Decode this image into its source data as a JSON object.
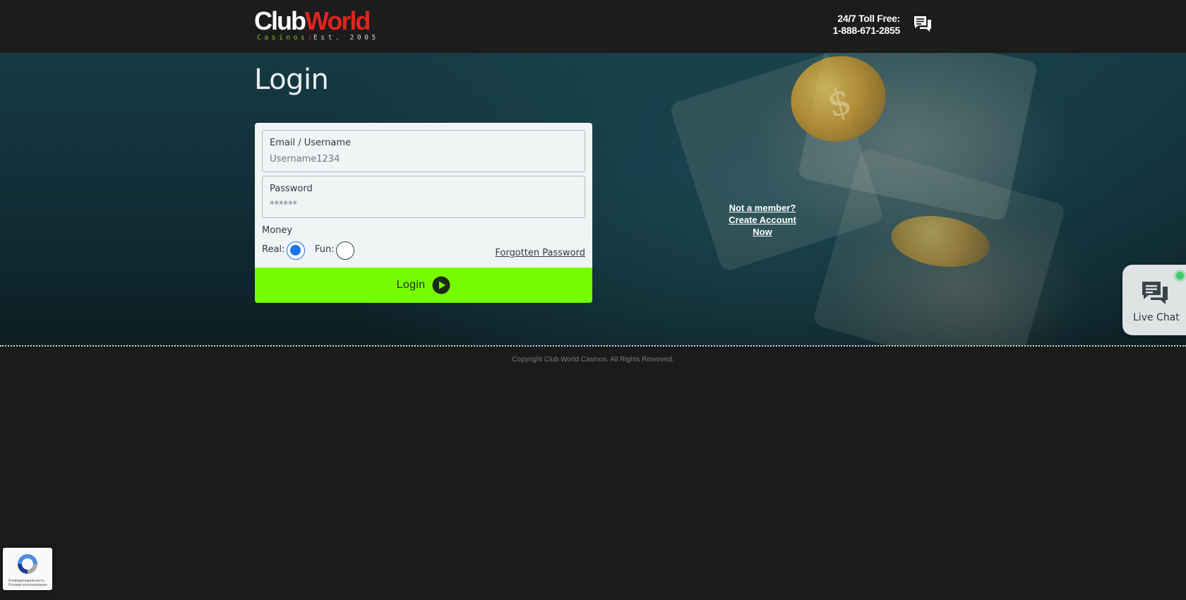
{
  "header": {
    "logo": {
      "club": "Club",
      "world": "World",
      "casinos": "Casinos",
      "separator": "|",
      "est": "Est. 2005"
    },
    "toll_free_label": "24/7 Toll Free:",
    "toll_free_number": "1-888-671-2855",
    "chat_icon": "chat-bubbles-icon"
  },
  "page": {
    "title": "Login"
  },
  "form": {
    "email_label": "Email / Username",
    "email_placeholder": "Username1234",
    "password_label": "Password",
    "password_placeholder": "******",
    "money_label": "Money",
    "real_label": "Real:",
    "fun_label": "Fun:",
    "selected_money": "Real",
    "forgot_label": "Forgotten Password",
    "login_label": "Login",
    "login_icon": "play-circle-icon"
  },
  "signup": {
    "line1": "Not a member?",
    "line2": "Create Account Now"
  },
  "live_chat": {
    "label": "Live Chat",
    "status": "online",
    "icon": "chat-bubbles-icon"
  },
  "footer": {
    "copyright": "Copyright Club World Casinos. All Rights Reserved."
  },
  "recaptcha": {
    "text": "Конфиденциальность - Условия использования"
  },
  "colors": {
    "header_bg": "#1c1c1c",
    "accent_green": "#76fc00",
    "logo_red": "#e3231f",
    "logo_green": "#86c12b",
    "radio_selected": "#1a73e8",
    "page_bg": "#1b1b1b"
  }
}
